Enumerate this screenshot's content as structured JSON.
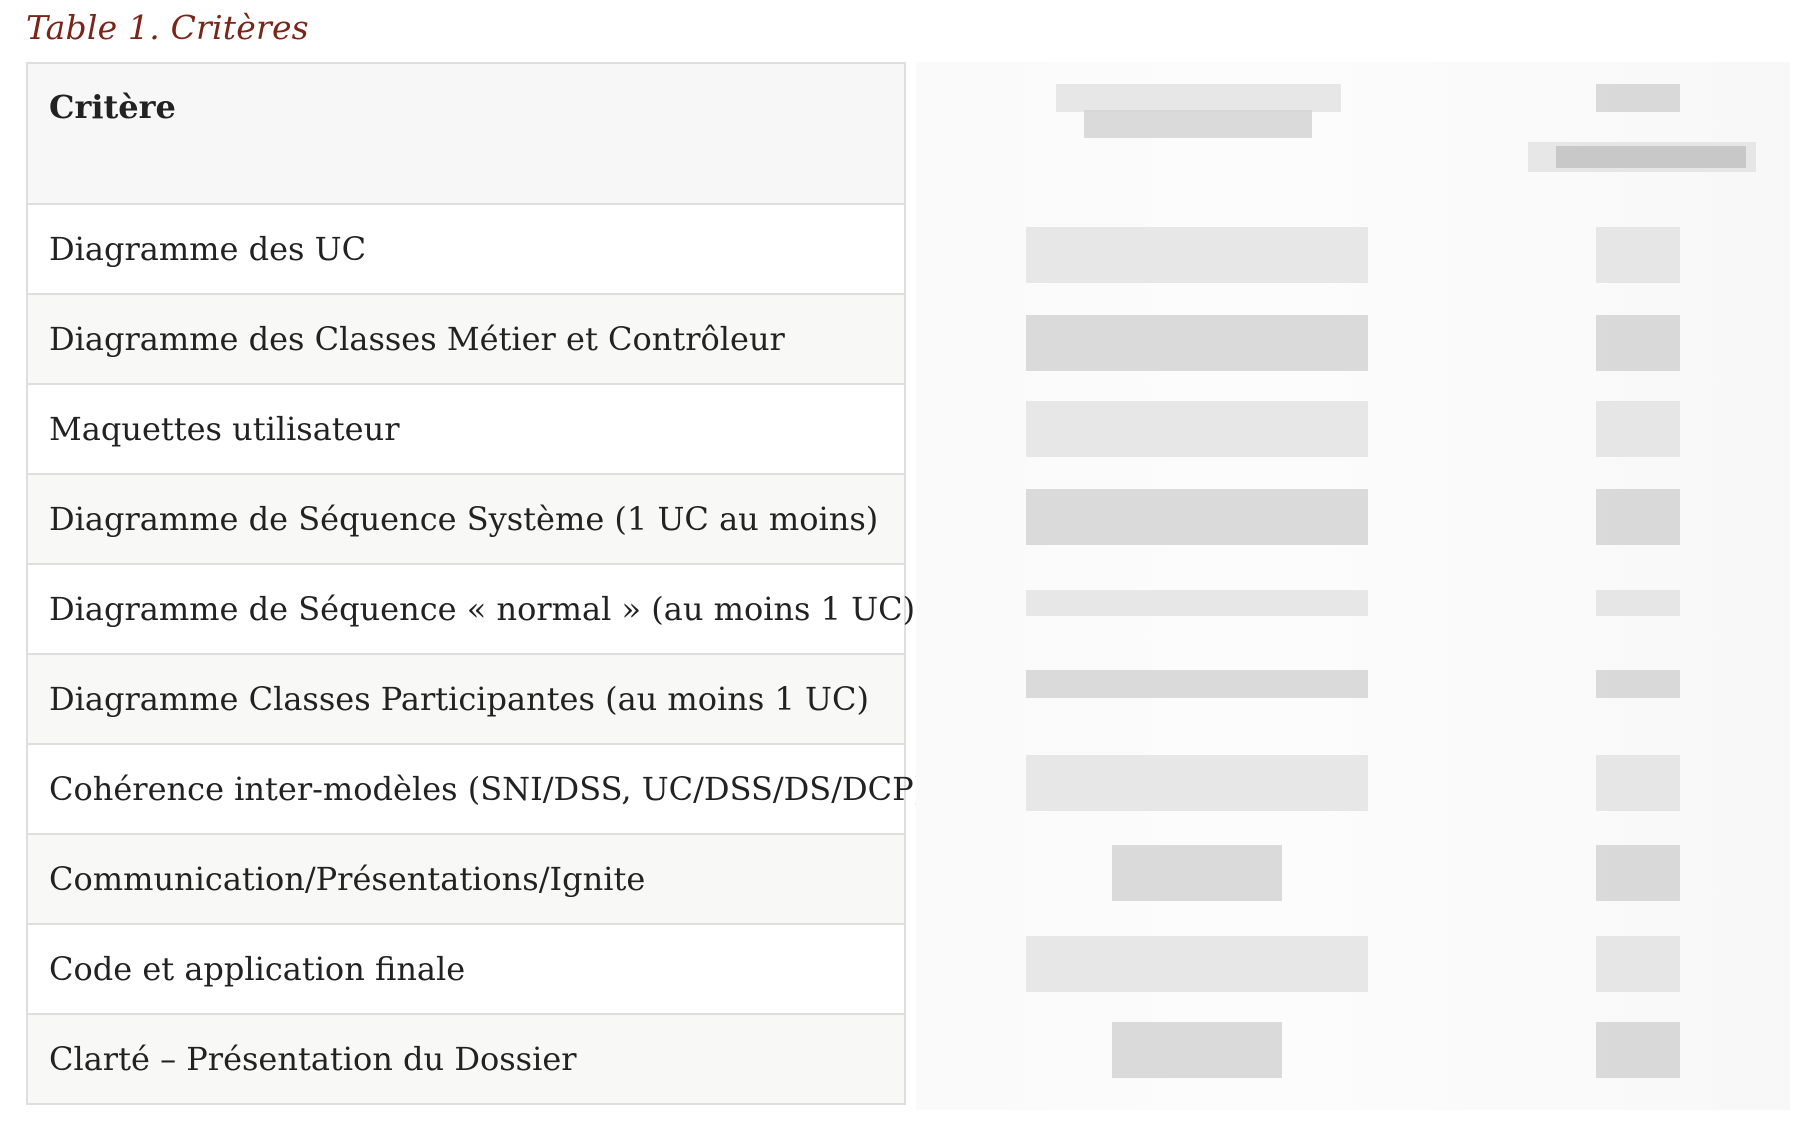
{
  "caption": "Table 1. Critères",
  "table": {
    "header": "Critère",
    "rows": [
      "Diagramme des UC",
      "Diagramme des Classes Métier et Contrôleur",
      "Maquettes utilisateur",
      "Diagramme de Séquence Système (1 UC au moins)",
      "Diagramme de Séquence « normal » (au moins 1 UC)",
      "Diagramme Classes Participantes (au moins 1 UC)",
      "Cohérence inter-modèles (SNI/DSS, UC/DSS/DS/DCP)",
      "Communication/Présentations/Ignite",
      "Code et application finale",
      "Clarté – Présentation du Dossier"
    ]
  },
  "colors": {
    "caption": "#7a2518",
    "border": "#dedede",
    "header_bg": "#f7f7f8",
    "stripe_bg": "#f8f8f7"
  }
}
